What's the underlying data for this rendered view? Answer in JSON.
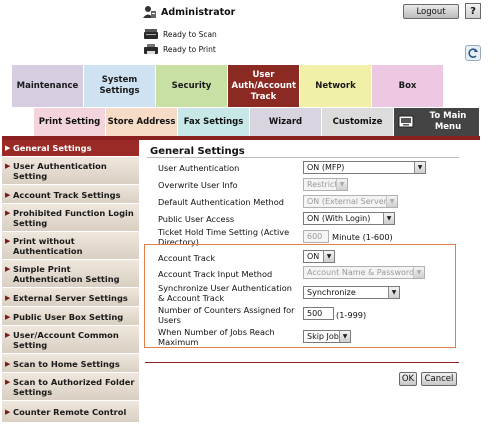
{
  "header": {
    "user": "Administrator",
    "logout_label": "Logout",
    "help_label": "?",
    "status_scan": "Ready to Scan",
    "status_print": "Ready to Print"
  },
  "tabs": [
    {
      "label": "Maintenance"
    },
    {
      "label": "System Settings"
    },
    {
      "label": "Security"
    },
    {
      "label": "User Auth/Account Track"
    },
    {
      "label": "Network"
    },
    {
      "label": "Box"
    }
  ],
  "subtabs": [
    {
      "label": "Print Setting"
    },
    {
      "label": "Store Address"
    },
    {
      "label": "Fax Settings"
    },
    {
      "label": "Wizard"
    },
    {
      "label": "Customize"
    },
    {
      "label": "To Main Menu"
    }
  ],
  "nav": [
    {
      "label": "General Settings"
    },
    {
      "label": "User Authentication Setting"
    },
    {
      "label": "Account Track Settings"
    },
    {
      "label": "Prohibited Function Login Setting"
    },
    {
      "label": "Print without Authentication"
    },
    {
      "label": "Simple Print Authentication Setting"
    },
    {
      "label": "External Server Settings"
    },
    {
      "label": "Public User Box Setting"
    },
    {
      "label": "User/Account Common Setting"
    },
    {
      "label": "Scan to Home Settings"
    },
    {
      "label": "Scan to Authorized Folder Settings"
    },
    {
      "label": "Counter Remote Control"
    }
  ],
  "main": {
    "title": "General Settings",
    "rows": [
      {
        "label": "User Authentication",
        "value": "ON (MFP)"
      },
      {
        "label": "Overwrite User Info",
        "value": "Restrict"
      },
      {
        "label": "Default Authentication Method",
        "value": "ON (External Server)"
      },
      {
        "label": "Public User Access",
        "value": "ON (With Login)"
      },
      {
        "label": "Ticket Hold Time Setting (Active Directory)",
        "value": "600",
        "suffix": "Minute (1-600)"
      },
      {
        "label": "Account Track",
        "value": "ON"
      },
      {
        "label": "Account Track Input Method",
        "value": "Account Name & Password"
      },
      {
        "label": "Synchronize User Authentication & Account Track",
        "value": "Synchronize"
      },
      {
        "label": "Number of Counters Assigned for Users",
        "value": "500",
        "suffix": "(1-999)"
      },
      {
        "label": "When Number of Jobs Reach Maximum",
        "value": "Skip Job"
      }
    ],
    "ok_label": "OK",
    "cancel_label": "Cancel"
  },
  "colors": {
    "accent": "#8a2020",
    "active_tab": "#8b2a22",
    "highlight_box": "#e0804a"
  }
}
